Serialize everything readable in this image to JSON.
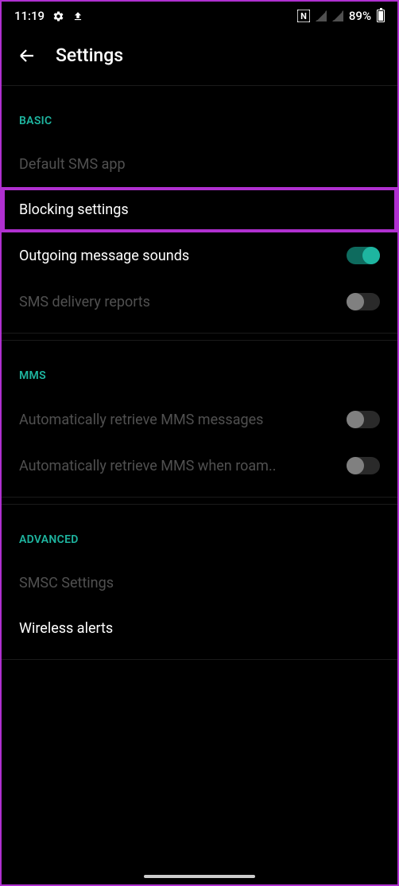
{
  "status_bar": {
    "time": "11:19",
    "battery_percent": "89%",
    "nfc_label": "N"
  },
  "header": {
    "title": "Settings"
  },
  "sections": {
    "basic": {
      "label": "BASIC",
      "default_sms": "Default SMS app",
      "blocking_settings": "Blocking settings",
      "outgoing_sounds": "Outgoing message sounds",
      "sms_delivery": "SMS delivery reports"
    },
    "mms": {
      "label": "MMS",
      "auto_retrieve": "Automatically retrieve MMS messages",
      "auto_retrieve_roaming": "Automatically retrieve MMS when roam.."
    },
    "advanced": {
      "label": "ADVANCED",
      "smsc": "SMSC Settings",
      "wireless_alerts": "Wireless alerts"
    }
  }
}
